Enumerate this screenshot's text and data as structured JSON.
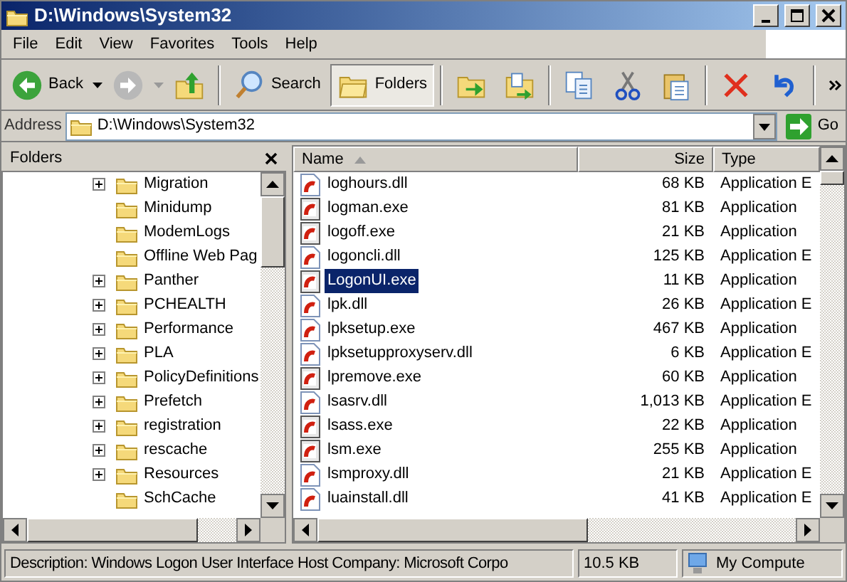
{
  "window": {
    "title": "D:\\Windows\\System32"
  },
  "menu": [
    "File",
    "Edit",
    "View",
    "Favorites",
    "Tools",
    "Help"
  ],
  "toolbar": [
    {
      "kind": "back",
      "label": "Back",
      "pressed": false
    },
    {
      "kind": "forward",
      "pressed": false
    },
    {
      "kind": "up",
      "pressed": false
    },
    {
      "kind": "search",
      "label": "Search",
      "pressed": false
    },
    {
      "kind": "folders",
      "label": "Folders",
      "pressed": true
    },
    {
      "kind": "move",
      "pressed": false
    },
    {
      "kind": "copyto",
      "pressed": false
    },
    {
      "kind": "copy",
      "pressed": false
    },
    {
      "kind": "cut",
      "pressed": false
    },
    {
      "kind": "paste",
      "pressed": false
    },
    {
      "kind": "delete",
      "pressed": false
    },
    {
      "kind": "undo",
      "pressed": false
    }
  ],
  "address": {
    "label": "Address",
    "value": "D:\\Windows\\System32",
    "go": "Go"
  },
  "folders_pane": {
    "title": "Folders",
    "items": [
      {
        "name": "Migration",
        "expandable": true
      },
      {
        "name": "Minidump",
        "expandable": false
      },
      {
        "name": "ModemLogs",
        "expandable": false
      },
      {
        "name": "Offline Web Pag",
        "expandable": false
      },
      {
        "name": "Panther",
        "expandable": true
      },
      {
        "name": "PCHEALTH",
        "expandable": true
      },
      {
        "name": "Performance",
        "expandable": true
      },
      {
        "name": "PLA",
        "expandable": true
      },
      {
        "name": "PolicyDefinitions",
        "expandable": true
      },
      {
        "name": "Prefetch",
        "expandable": true
      },
      {
        "name": "registration",
        "expandable": true
      },
      {
        "name": "rescache",
        "expandable": true
      },
      {
        "name": "Resources",
        "expandable": true
      },
      {
        "name": "SchCache",
        "expandable": false
      }
    ]
  },
  "file_list": {
    "columns": [
      "Name",
      "Size",
      "Type"
    ],
    "rows": [
      {
        "kind": "dll",
        "name": "loghours.dll",
        "size": "68 KB",
        "type": "Application E",
        "selected": false
      },
      {
        "kind": "exe",
        "name": "logman.exe",
        "size": "81 KB",
        "type": "Application",
        "selected": false
      },
      {
        "kind": "exe",
        "name": "logoff.exe",
        "size": "21 KB",
        "type": "Application",
        "selected": false
      },
      {
        "kind": "dll",
        "name": "logoncli.dll",
        "size": "125 KB",
        "type": "Application E",
        "selected": false
      },
      {
        "kind": "exe",
        "name": "LogonUI.exe",
        "size": "11 KB",
        "type": "Application",
        "selected": true
      },
      {
        "kind": "dll",
        "name": "lpk.dll",
        "size": "26 KB",
        "type": "Application E",
        "selected": false
      },
      {
        "kind": "dll",
        "name": "lpksetup.exe",
        "size": "467 KB",
        "type": "Application",
        "selected": false
      },
      {
        "kind": "dll",
        "name": "lpksetupproxyserv.dll",
        "size": "6 KB",
        "type": "Application E",
        "selected": false
      },
      {
        "kind": "exe",
        "name": "lpremove.exe",
        "size": "60 KB",
        "type": "Application",
        "selected": false
      },
      {
        "kind": "dll",
        "name": "lsasrv.dll",
        "size": "1,013 KB",
        "type": "Application E",
        "selected": false
      },
      {
        "kind": "exe",
        "name": "lsass.exe",
        "size": "22 KB",
        "type": "Application",
        "selected": false
      },
      {
        "kind": "exe",
        "name": "lsm.exe",
        "size": "255 KB",
        "type": "Application",
        "selected": false
      },
      {
        "kind": "dll",
        "name": "lsmproxy.dll",
        "size": "21 KB",
        "type": "Application E",
        "selected": false
      },
      {
        "kind": "dll",
        "name": "luainstall.dll",
        "size": "41 KB",
        "type": "Application E",
        "selected": false
      }
    ]
  },
  "status_bar": {
    "description": "Description: Windows Logon User Interface Host Company: Microsoft Corpo",
    "size": "10.5 KB",
    "zone": "My Compute"
  }
}
